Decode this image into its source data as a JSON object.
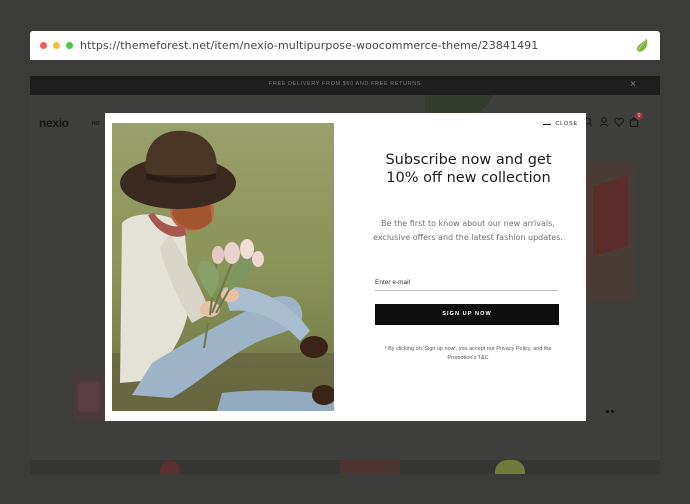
{
  "browser": {
    "url": "https://themeforest.net/item/nexio-multipurpose-woocommerce-theme/23841491"
  },
  "site": {
    "promo_text": "FREE DELIVERY FROM $60 AND FREE RETURNS",
    "promo_close": "×",
    "logo": "nexio",
    "nav_fragment": "HO",
    "cart_count": "0"
  },
  "modal": {
    "close_label": "CLOSE",
    "title": "Subscribe now and get 10% off new collection",
    "description": "Be the first to know about our new arrivals, exclusive offers and the latest fashion updates.",
    "email_placeholder": "Enter e-mail",
    "signup_label": "SIGN UP NOW",
    "note": "* By clicking on 'Sign up now', you accept our Privacy Policy, and the Promotion's T&C"
  },
  "colors": {
    "backdrop": "#3b3b39",
    "modal_bg": "#ffffff",
    "button_bg": "#0e0e0e",
    "envato_green": "#81b441"
  },
  "icons": [
    "envato-leaf-icon",
    "search-icon",
    "user-icon",
    "heart-icon",
    "cart-icon",
    "close-icon"
  ]
}
